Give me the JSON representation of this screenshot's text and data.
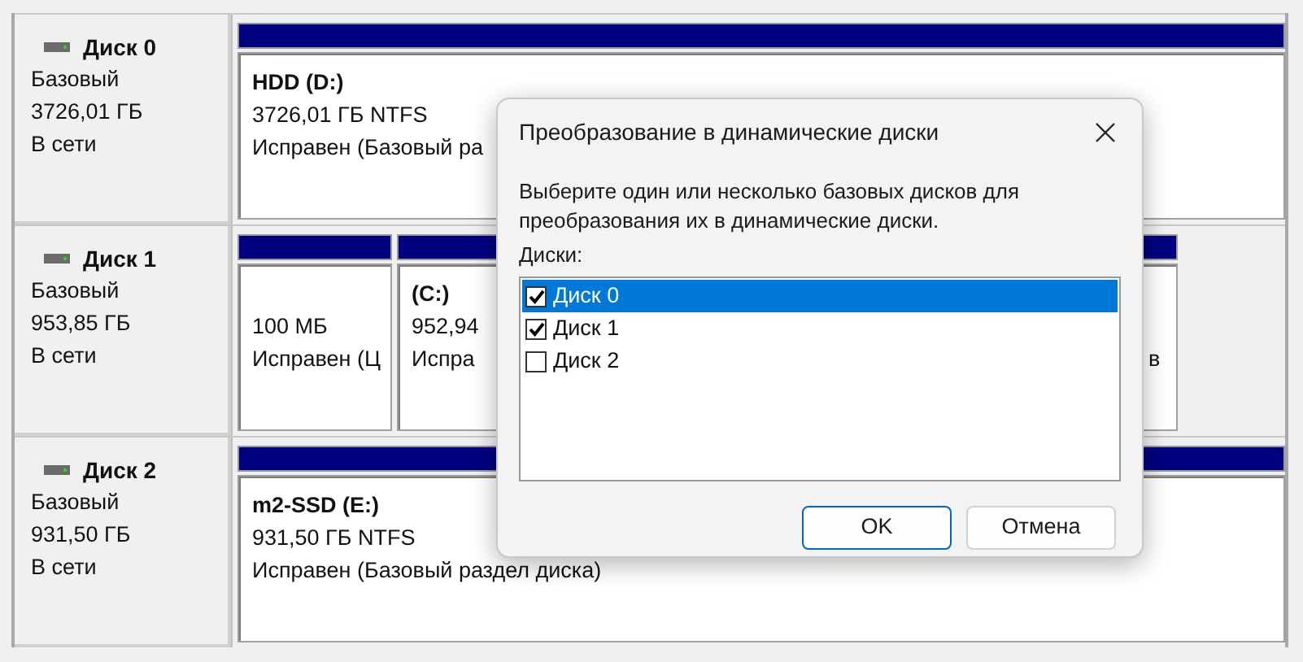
{
  "disks": [
    {
      "name": "Диск 0",
      "type": "Базовый",
      "size": "3726,01 ГБ",
      "status": "В сети",
      "partitions": [
        {
          "title": "HDD  (D:)",
          "size": "3726,01 ГБ NTFS",
          "status": "Исправен (Базовый ра"
        }
      ]
    },
    {
      "name": "Диск 1",
      "type": "Базовый",
      "size": "953,85 ГБ",
      "status": "В сети",
      "partitions": [
        {
          "size": "100 МБ",
          "status": "Исправен (Ц"
        },
        {
          "title": "(C:)",
          "size": "952,94",
          "status": "Испра"
        },
        {
          "status": "в"
        }
      ]
    },
    {
      "name": "Диск 2",
      "type": "Базовый",
      "size": "931,50 ГБ",
      "status": "В сети",
      "partitions": [
        {
          "title": "m2-SSD  (E:)",
          "size": "931,50 ГБ NTFS",
          "status": "Исправен (Базовый раздел диска)"
        }
      ]
    }
  ],
  "dialog": {
    "title": "Преобразование в динамические диски",
    "description": "Выберите один или несколько базовых дисков для преобразования их в динамические диски.",
    "list_label": "Диски:",
    "items": [
      {
        "label": "Диск 0",
        "checked": true,
        "selected": true
      },
      {
        "label": "Диск 1",
        "checked": true,
        "selected": false
      },
      {
        "label": "Диск 2",
        "checked": false,
        "selected": false
      }
    ],
    "buttons": [
      "OK",
      "Отмена"
    ]
  }
}
